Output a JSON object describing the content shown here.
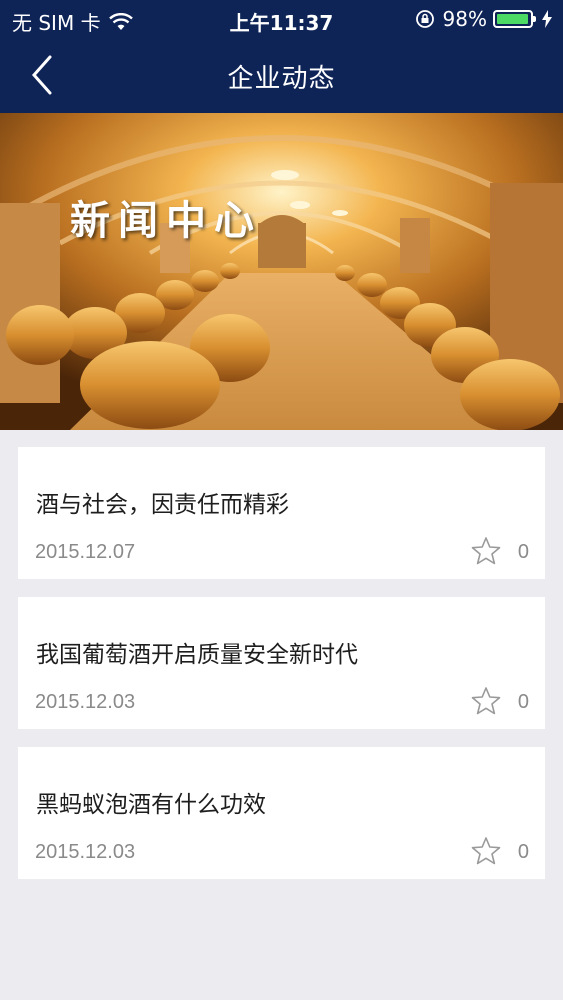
{
  "status_bar": {
    "carrier": "无 SIM 卡",
    "time": "上午11:37",
    "battery": "98%",
    "battery_level": 0.98,
    "battery_color": "#4cd964"
  },
  "nav": {
    "title": "企业动态",
    "back_icon": "chevron-left-icon",
    "background": "#0e2457"
  },
  "banner": {
    "title": "新闻中心"
  },
  "news": [
    {
      "title": "酒与社会，因责任而精彩",
      "date": "2015.12.07",
      "likes": "0"
    },
    {
      "title": "我国葡萄酒开启质量安全新时代",
      "date": "2015.12.03",
      "likes": "0"
    },
    {
      "title": "黑蚂蚁泡酒有什么功效",
      "date": "2015.12.03",
      "likes": "0"
    }
  ]
}
